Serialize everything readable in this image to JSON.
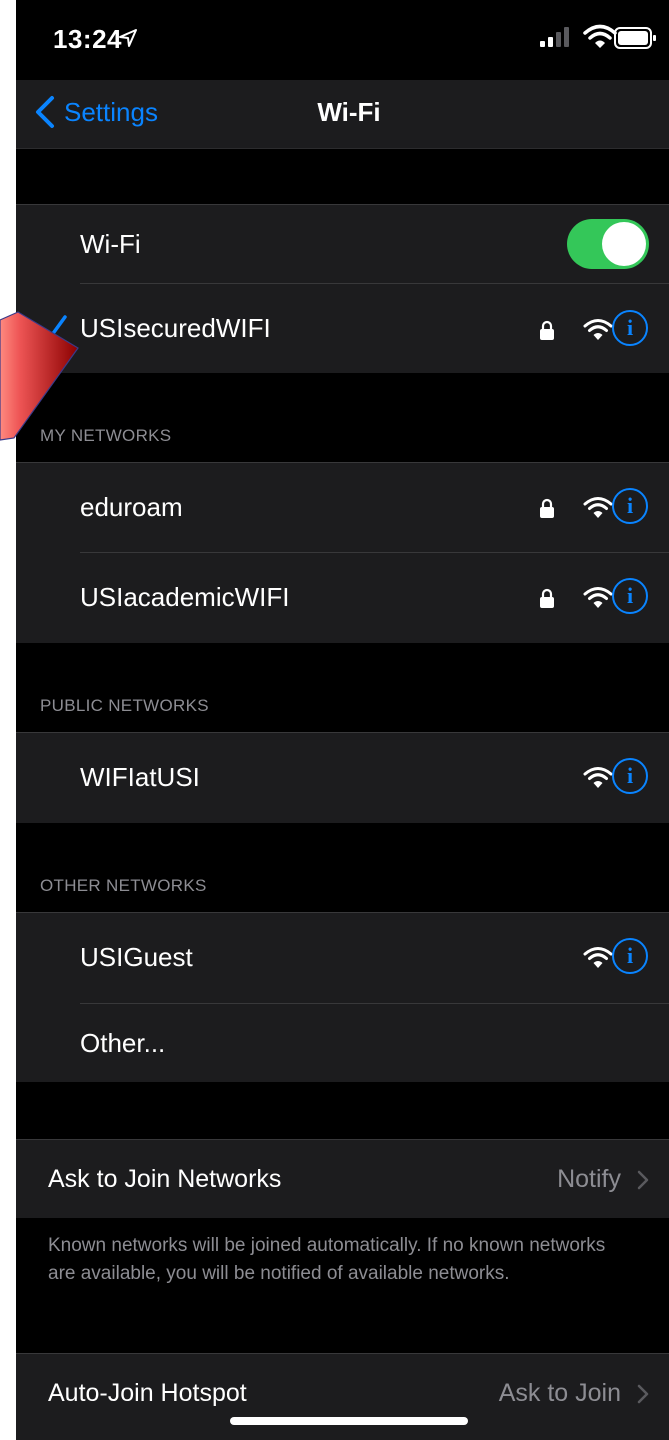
{
  "status_bar": {
    "time": "13:24"
  },
  "nav": {
    "back_label": "Settings",
    "title": "Wi-Fi"
  },
  "wifi_toggle": {
    "label": "Wi-Fi",
    "state": "on"
  },
  "connected_network": {
    "name": "USIsecuredWIFI",
    "secured": true
  },
  "my_networks": {
    "header": "MY NETWORKS",
    "items": [
      {
        "name": "eduroam",
        "secured": true
      },
      {
        "name": "USIacademicWIFI",
        "secured": true
      }
    ]
  },
  "public_networks": {
    "header": "PUBLIC NETWORKS",
    "items": [
      {
        "name": "WIFIatUSI",
        "secured": false
      }
    ]
  },
  "other_networks": {
    "header": "OTHER NETWORKS",
    "items": [
      {
        "name": "USIGuest",
        "secured": false
      }
    ],
    "other_label": "Other..."
  },
  "ask_to_join": {
    "label": "Ask to Join Networks",
    "value": "Notify",
    "footnote": "Known networks will be joined automatically. If no known networks are available, you will be notified of available networks."
  },
  "auto_join_hotspot": {
    "label": "Auto-Join Hotspot",
    "value": "Ask to Join"
  },
  "colors": {
    "accent": "#0a84ff",
    "toggle_on": "#34c759",
    "background": "#000000",
    "cell_background": "#1c1c1e",
    "secondary_text": "#8d8d93"
  },
  "icons": [
    "location-arrow-icon",
    "cellular-signal-icon",
    "wifi-icon",
    "battery-icon",
    "chevron-left-icon",
    "checkmark-icon",
    "lock-icon",
    "info-icon",
    "chevron-right-icon"
  ]
}
